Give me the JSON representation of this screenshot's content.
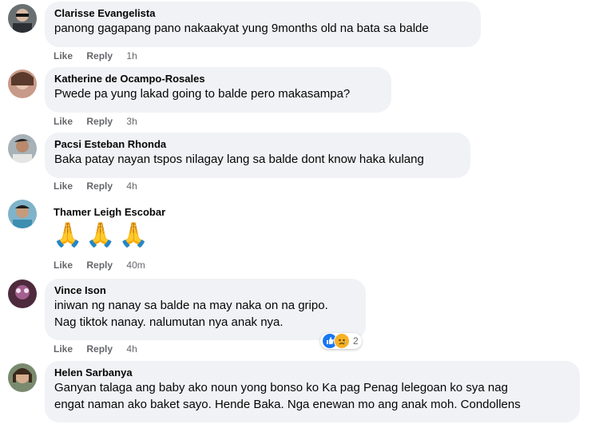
{
  "comments": [
    {
      "name": "Clarisse Evangelista",
      "text": "panong gagapang pano nakaakyat yung 9months old na bata sa balde",
      "like": "Like",
      "reply": "Reply",
      "time": "1h"
    },
    {
      "name": "Katherine de Ocampo-Rosales",
      "text": "Pwede pa yung lakad going to balde pero makasampa?",
      "like": "Like",
      "reply": "Reply",
      "time": "3h"
    },
    {
      "name": "Pacsi Esteban Rhonda",
      "text": "Baka patay nayan tspos nilagay lang sa balde dont know haka kulang",
      "like": "Like",
      "reply": "Reply",
      "time": "4h"
    },
    {
      "name": "Thamer Leigh Escobar",
      "text": "🙏🙏🙏",
      "like": "Like",
      "reply": "Reply",
      "time": "40m"
    },
    {
      "name": "Vince Ison",
      "text": "iniwan ng nanay sa balde na may naka on na gripo.\nNag tiktok nanay. nalumutan nya anak nya.",
      "like": "Like",
      "reply": "Reply",
      "time": "4h",
      "reaction_count": "2"
    },
    {
      "name": "Helen Sarbanya",
      "text": "Ganyan talaga ang baby ako noun yong bonso ko Ka pag Penag lelegoan ko sya nag\nengat naman ako baket sayo. Hende Baka. Nga enewan mo ang anak moh. Condollens"
    }
  ],
  "colors": {
    "bubble": "#f0f2f5",
    "meta": "#65676b",
    "like_blue": "#1877f2",
    "sad_yellow": "#f7b125"
  }
}
